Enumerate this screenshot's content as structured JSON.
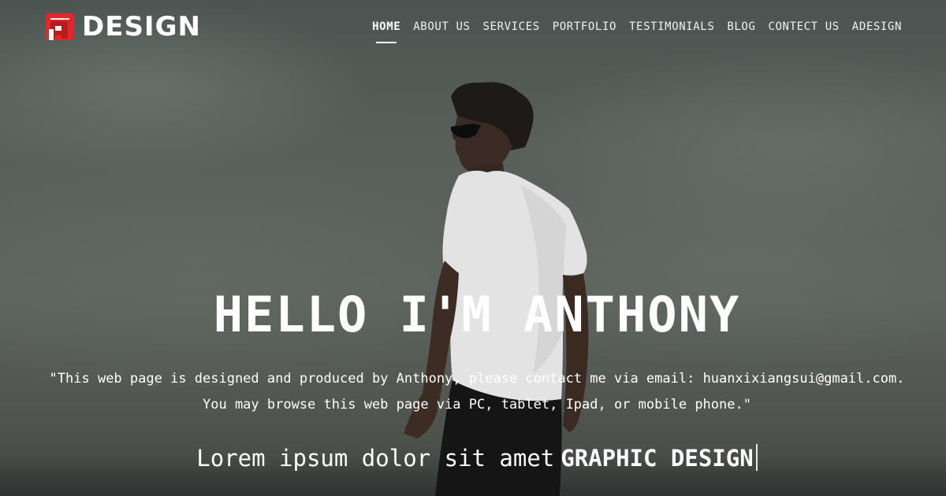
{
  "header": {
    "logo_text": "DESIGN",
    "logo_icon": "letter-a-logo-icon",
    "brand_color": "#e0282b"
  },
  "nav": {
    "items": [
      {
        "label": "HOME",
        "active": true
      },
      {
        "label": "ABOUT US",
        "active": false
      },
      {
        "label": "SERVICES",
        "active": false
      },
      {
        "label": "PORTFOLIO",
        "active": false
      },
      {
        "label": "TESTIMONIALS",
        "active": false
      },
      {
        "label": "BLOG",
        "active": false
      },
      {
        "label": "CONTECT US",
        "active": false
      },
      {
        "label": "ADESIGN",
        "active": false
      }
    ]
  },
  "hero": {
    "title": "HELLO I'M ANTHONY",
    "quote_line1": "\"This web page is designed and produced by Anthony, please contact me via email: huanxixiangsui@gmail.com.",
    "quote_line2": "You may browse this web page via PC, tablet, Ipad, or mobile phone.\"",
    "tagline_prefix": "Lorem ipsum dolor sit amet",
    "tagline_typed": "GRAPHIC DESIGN"
  }
}
